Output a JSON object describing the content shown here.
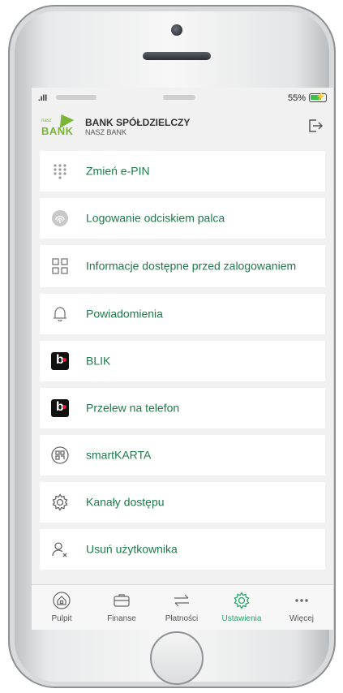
{
  "status_bar": {
    "battery": "55%"
  },
  "header": {
    "logo_small": "nasz",
    "logo_word": "BANK",
    "bank_name": "BANK SPÓŁDZIELCZY",
    "bank_sub": "NASZ BANK"
  },
  "menu": [
    {
      "label": "Zmień e-PIN",
      "icon": "keypad-icon"
    },
    {
      "label": "Logowanie odciskiem palca",
      "icon": "fingerprint-icon"
    },
    {
      "label": "Informacje dostępne przed zalogowaniem",
      "icon": "grid-icon"
    },
    {
      "label": "Powiadomienia",
      "icon": "bell-icon"
    },
    {
      "label": "BLIK",
      "icon": "blik-icon"
    },
    {
      "label": "Przelew na telefon",
      "icon": "blik-icon"
    },
    {
      "label": "smartKARTA",
      "icon": "qr-icon"
    },
    {
      "label": "Kanały dostępu",
      "icon": "gear-icon"
    },
    {
      "label": "Usuń użytkownika",
      "icon": "remove-user-icon"
    }
  ],
  "tabs": [
    {
      "label": "Pulpit",
      "icon": "home-icon",
      "active": false
    },
    {
      "label": "Finanse",
      "icon": "wallet-icon",
      "active": false
    },
    {
      "label": "Płatności",
      "icon": "transfer-icon",
      "active": false
    },
    {
      "label": "Ustawienia",
      "icon": "gear-icon",
      "active": true
    },
    {
      "label": "Więcej",
      "icon": "more-icon",
      "active": false
    }
  ],
  "colors": {
    "accent": "#1e7a4a",
    "active_tab": "#2aa56b",
    "brand_green": "#7ab537",
    "blik_red": "#e21b3c"
  }
}
